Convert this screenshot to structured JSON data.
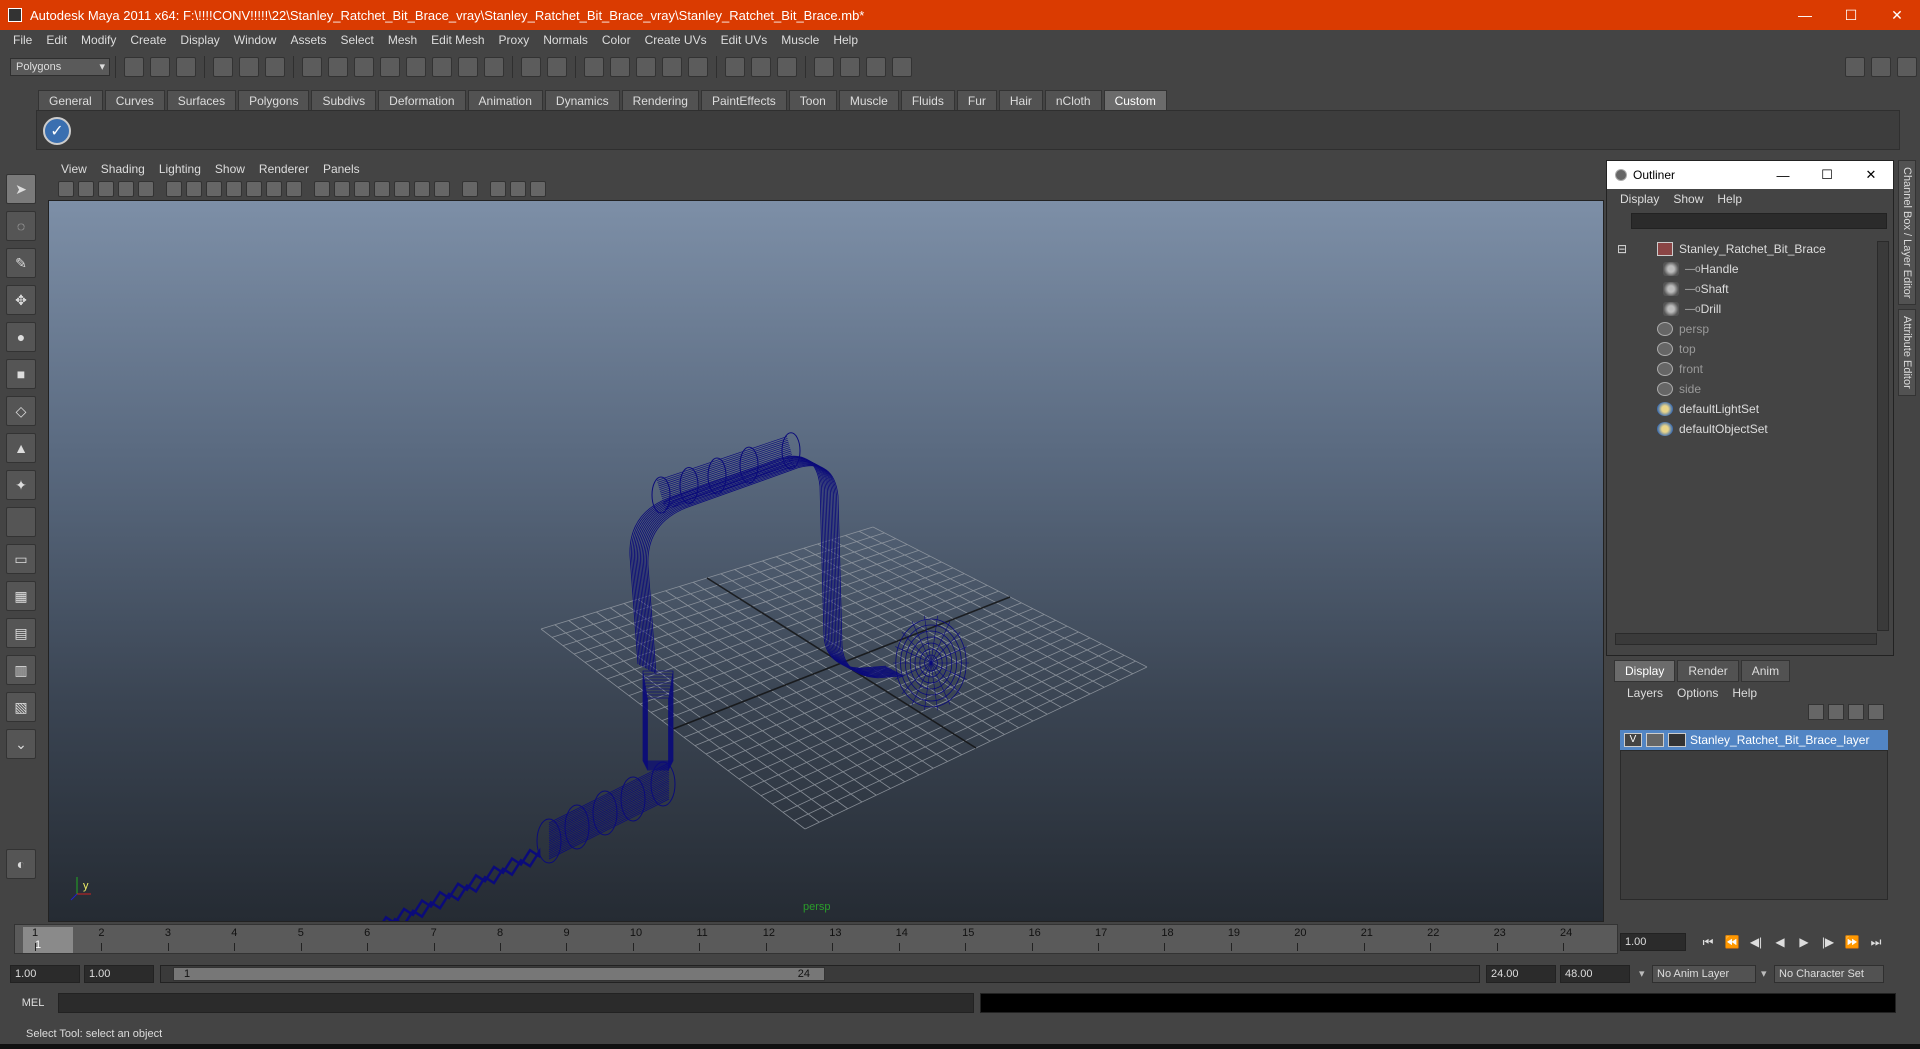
{
  "window": {
    "title": "Autodesk Maya 2011 x64: F:\\!!!!CONV!!!!!\\22\\Stanley_Ratchet_Bit_Brace_vray\\Stanley_Ratchet_Bit_Brace_vray\\Stanley_Ratchet_Bit_Brace.mb*",
    "minimize": "—",
    "maximize": "☐",
    "close": "✕"
  },
  "menubar": [
    "File",
    "Edit",
    "Modify",
    "Create",
    "Display",
    "Window",
    "Assets",
    "Select",
    "Mesh",
    "Edit Mesh",
    "Proxy",
    "Normals",
    "Color",
    "Create UVs",
    "Edit UVs",
    "Muscle",
    "Help"
  ],
  "statusline": {
    "menuset": "Polygons"
  },
  "shelf": {
    "tabs": [
      "General",
      "Curves",
      "Surfaces",
      "Polygons",
      "Subdivs",
      "Deformation",
      "Animation",
      "Dynamics",
      "Rendering",
      "PaintEffects",
      "Toon",
      "Muscle",
      "Fluids",
      "Fur",
      "Hair",
      "nCloth",
      "Custom"
    ],
    "active_tab": "Custom"
  },
  "panel": {
    "menu": [
      "View",
      "Shading",
      "Lighting",
      "Show",
      "Renderer",
      "Panels"
    ],
    "camera": "persp",
    "axis_y": "y"
  },
  "outliner": {
    "title": "Outliner",
    "menu": [
      "Display",
      "Show",
      "Help"
    ],
    "items": [
      {
        "label": "Stanley_Ratchet_Bit_Brace",
        "indent": 0,
        "icon": "group-icon",
        "dim": false
      },
      {
        "label": "Handle",
        "indent": 1,
        "icon": "transform-icon",
        "dim": false
      },
      {
        "label": "Shaft",
        "indent": 1,
        "icon": "transform-icon",
        "dim": false
      },
      {
        "label": "Drill",
        "indent": 1,
        "icon": "transform-icon",
        "dim": false
      },
      {
        "label": "persp",
        "indent": 0,
        "icon": "camera-icon",
        "dim": true
      },
      {
        "label": "top",
        "indent": 0,
        "icon": "camera-icon",
        "dim": true
      },
      {
        "label": "front",
        "indent": 0,
        "icon": "camera-icon",
        "dim": true
      },
      {
        "label": "side",
        "indent": 0,
        "icon": "camera-icon",
        "dim": true
      },
      {
        "label": "defaultLightSet",
        "indent": 0,
        "icon": "set-icon",
        "dim": false
      },
      {
        "label": "defaultObjectSet",
        "indent": 0,
        "icon": "set-icon",
        "dim": false
      }
    ]
  },
  "layer_editor": {
    "tabs": [
      "Display",
      "Render",
      "Anim"
    ],
    "active_tab": "Display",
    "menu": [
      "Layers",
      "Options",
      "Help"
    ],
    "layer": {
      "visible": "V",
      "name": "Stanley_Ratchet_Bit_Brace_layer"
    }
  },
  "side_tabs": [
    "Channel Box / Layer Editor",
    "Attribute Editor"
  ],
  "timeline": {
    "ticks": [
      "1",
      "2",
      "3",
      "4",
      "5",
      "6",
      "7",
      "8",
      "9",
      "10",
      "11",
      "12",
      "13",
      "14",
      "15",
      "16",
      "17",
      "18",
      "19",
      "20",
      "21",
      "22",
      "23",
      "24"
    ],
    "current_frame": "1",
    "current_time_field": "1.00",
    "playback_buttons": [
      "⏮",
      "⏪",
      "◀|",
      "◀",
      "▶",
      "|▶",
      "⏩",
      "⏭"
    ]
  },
  "range": {
    "start": "1.00",
    "playback_start": "1.00",
    "handle_start": "1",
    "handle_end": "24",
    "playback_end": "24.00",
    "end": "48.00",
    "anim_layer": "No Anim Layer",
    "char_set": "No Character Set"
  },
  "cmdline": {
    "label": "MEL"
  },
  "helpline": "Select Tool: select an object",
  "colors": {
    "title": "#da3b01",
    "wire": "#0b0b7a",
    "selection": "#5285c4"
  }
}
